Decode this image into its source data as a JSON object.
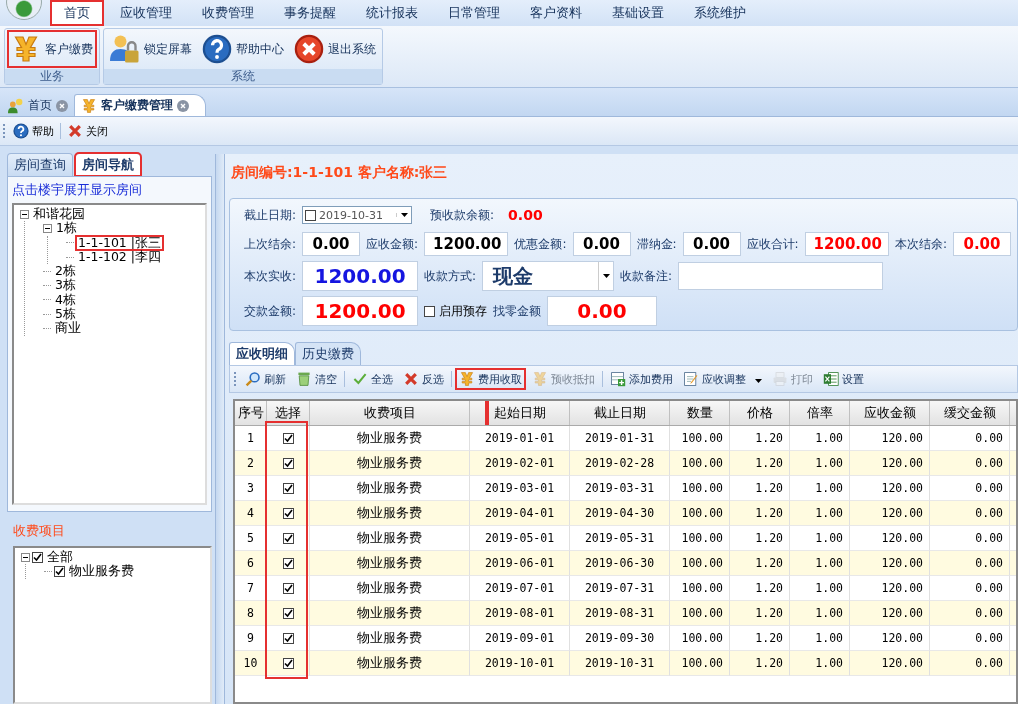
{
  "menu": [
    {
      "label": "首页",
      "selected": true,
      "highlighted": true
    },
    {
      "label": "应收管理",
      "selected": false,
      "highlighted": false
    },
    {
      "label": "收费管理",
      "selected": false,
      "highlighted": false
    },
    {
      "label": "事务提醒",
      "selected": false,
      "highlighted": false
    },
    {
      "label": "统计报表",
      "selected": false,
      "highlighted": false
    },
    {
      "label": "日常管理",
      "selected": false,
      "highlighted": false
    },
    {
      "label": "客户资料",
      "selected": false,
      "highlighted": false
    },
    {
      "label": "基础设置",
      "selected": false,
      "highlighted": false
    },
    {
      "label": "系统维护",
      "selected": false,
      "highlighted": false
    }
  ],
  "ribbon": [
    {
      "label": "业务",
      "buttons": [
        {
          "label": "客户缴费",
          "kind": "yen",
          "highlighted": true
        }
      ]
    },
    {
      "label": "系统",
      "buttons": [
        {
          "label": "锁定屏幕",
          "kind": "lock",
          "highlighted": false
        },
        {
          "label": "帮助中心",
          "kind": "help",
          "highlighted": false
        },
        {
          "label": "退出系统",
          "kind": "exit",
          "highlighted": false
        }
      ]
    }
  ],
  "doc_tabs": [
    {
      "label": "首页",
      "kind": "users",
      "selected": false
    },
    {
      "label": "客户缴费管理",
      "kind": "yen",
      "selected": true
    }
  ],
  "toolbar": [
    {
      "label": "帮助",
      "kind": "help"
    },
    {
      "label": "关闭",
      "kind": "x"
    }
  ],
  "left_tabs": [
    {
      "label": "房间查询",
      "selected": false,
      "highlighted": false
    },
    {
      "label": "房间导航",
      "selected": true,
      "highlighted": true
    }
  ],
  "tree_hint": "点击楼宇展开显示房间",
  "tree": [
    {
      "label": "和谐花园",
      "expanded": true,
      "children": [
        {
          "label": "1栋",
          "expanded": true,
          "children": [
            {
              "label": "1-1-101 |张三",
              "highlighted": true
            },
            {
              "label": "1-1-102 |李四",
              "highlighted": false
            }
          ]
        },
        {
          "label": "2栋"
        },
        {
          "label": "3栋"
        },
        {
          "label": "4栋"
        },
        {
          "label": "5栋"
        },
        {
          "label": "商业"
        }
      ]
    }
  ],
  "fee_section": {
    "title": "收费项目",
    "tree": [
      {
        "label": "全部",
        "checked": true,
        "expanded": true,
        "children": [
          {
            "label": "物业服务费",
            "checked": true
          }
        ]
      }
    ]
  },
  "room_title": "房间编号:1-1-101 客户名称:张三",
  "form": {
    "end_date": {
      "label": "截止日期:",
      "value": "2019-10-31",
      "checked": false
    },
    "prepaid": {
      "label": "预收款余额:",
      "value": "0.00"
    },
    "row2": [
      {
        "label": "上次结余:",
        "value": "0.00",
        "red": false
      },
      {
        "label": "应收金额:",
        "value": "1200.00",
        "red": false
      },
      {
        "label": "优惠金额:",
        "value": "0.00",
        "red": false
      },
      {
        "label": "滞纳金:",
        "value": "0.00",
        "red": false
      },
      {
        "label": "应收合计:",
        "value": "1200.00",
        "red": true
      },
      {
        "label": "本次结余:",
        "value": "0.00",
        "red": true
      }
    ],
    "actual": {
      "label": "本次实收:",
      "value": "1200.00"
    },
    "method": {
      "label": "收款方式:",
      "value": "现金"
    },
    "note": {
      "label": "收款备注:"
    },
    "paid": {
      "label": "交款金额:",
      "value": "1200.00"
    },
    "use_prepaid": {
      "label": "启用预存",
      "checked": false
    },
    "change": {
      "label": "找零金额",
      "value": "0.00"
    }
  },
  "detail_tabs": [
    {
      "label": "应收明细",
      "selected": true
    },
    {
      "label": "历史缴费",
      "selected": false
    }
  ],
  "grid_toolbar": [
    {
      "label": "刷新",
      "kind": "search",
      "disabled": false,
      "highlighted": false,
      "dropdown": false,
      "sep": false
    },
    {
      "label": "清空",
      "kind": "bin",
      "disabled": false,
      "highlighted": false,
      "dropdown": false,
      "sep": true
    },
    {
      "label": "全选",
      "kind": "check",
      "disabled": false,
      "highlighted": false,
      "dropdown": false,
      "sep": false
    },
    {
      "label": "反选",
      "kind": "x",
      "disabled": false,
      "highlighted": false,
      "dropdown": false,
      "sep": true
    },
    {
      "label": "费用收取",
      "kind": "yen",
      "disabled": false,
      "highlighted": true,
      "dropdown": false,
      "sep": false
    },
    {
      "label": "预收抵扣",
      "kind": "yen",
      "disabled": true,
      "highlighted": false,
      "dropdown": false,
      "sep": true
    },
    {
      "label": "添加费用",
      "kind": "add",
      "disabled": false,
      "highlighted": false,
      "dropdown": false,
      "sep": false
    },
    {
      "label": "应收调整",
      "kind": "edit",
      "disabled": false,
      "highlighted": false,
      "dropdown": true,
      "sep": false
    },
    {
      "label": "打印",
      "kind": "print",
      "disabled": true,
      "highlighted": false,
      "dropdown": false,
      "sep": false
    },
    {
      "label": "设置",
      "kind": "excel",
      "disabled": false,
      "highlighted": false,
      "dropdown": false,
      "sep": false
    }
  ],
  "table": {
    "columns": [
      {
        "label": "序号",
        "highlighted": false
      },
      {
        "label": "选择",
        "highlighted": true
      },
      {
        "label": "收费项目",
        "highlighted": false
      },
      {
        "label": "起始日期",
        "highlighted": false
      },
      {
        "label": "截止日期",
        "highlighted": false
      },
      {
        "label": "数量",
        "highlighted": false
      },
      {
        "label": "价格",
        "highlighted": false
      },
      {
        "label": "倍率",
        "highlighted": false
      },
      {
        "label": "应收金额",
        "highlighted": false
      },
      {
        "label": "缓交金额",
        "highlighted": false
      }
    ],
    "rows": [
      {
        "no": "1",
        "checked": true,
        "item": "物业服务费",
        "start": "2019-01-01",
        "end": "2019-01-31",
        "qty": "100.00",
        "price": "1.20",
        "rate": "1.00",
        "due": "120.00",
        "deferred": "0.00"
      },
      {
        "no": "2",
        "checked": true,
        "item": "物业服务费",
        "start": "2019-02-01",
        "end": "2019-02-28",
        "qty": "100.00",
        "price": "1.20",
        "rate": "1.00",
        "due": "120.00",
        "deferred": "0.00"
      },
      {
        "no": "3",
        "checked": true,
        "item": "物业服务费",
        "start": "2019-03-01",
        "end": "2019-03-31",
        "qty": "100.00",
        "price": "1.20",
        "rate": "1.00",
        "due": "120.00",
        "deferred": "0.00"
      },
      {
        "no": "4",
        "checked": true,
        "item": "物业服务费",
        "start": "2019-04-01",
        "end": "2019-04-30",
        "qty": "100.00",
        "price": "1.20",
        "rate": "1.00",
        "due": "120.00",
        "deferred": "0.00"
      },
      {
        "no": "5",
        "checked": true,
        "item": "物业服务费",
        "start": "2019-05-01",
        "end": "2019-05-31",
        "qty": "100.00",
        "price": "1.20",
        "rate": "1.00",
        "due": "120.00",
        "deferred": "0.00"
      },
      {
        "no": "6",
        "checked": true,
        "item": "物业服务费",
        "start": "2019-06-01",
        "end": "2019-06-30",
        "qty": "100.00",
        "price": "1.20",
        "rate": "1.00",
        "due": "120.00",
        "deferred": "0.00"
      },
      {
        "no": "7",
        "checked": true,
        "item": "物业服务费",
        "start": "2019-07-01",
        "end": "2019-07-31",
        "qty": "100.00",
        "price": "1.20",
        "rate": "1.00",
        "due": "120.00",
        "deferred": "0.00"
      },
      {
        "no": "8",
        "checked": true,
        "item": "物业服务费",
        "start": "2019-08-01",
        "end": "2019-08-31",
        "qty": "100.00",
        "price": "1.20",
        "rate": "1.00",
        "due": "120.00",
        "deferred": "0.00"
      },
      {
        "no": "9",
        "checked": true,
        "item": "物业服务费",
        "start": "2019-09-01",
        "end": "2019-09-30",
        "qty": "100.00",
        "price": "1.20",
        "rate": "1.00",
        "due": "120.00",
        "deferred": "0.00"
      },
      {
        "no": "10",
        "checked": true,
        "item": "物业服务费",
        "start": "2019-10-01",
        "end": "2019-10-31",
        "qty": "100.00",
        "price": "1.20",
        "rate": "1.00",
        "due": "120.00",
        "deferred": "0.00"
      }
    ]
  }
}
